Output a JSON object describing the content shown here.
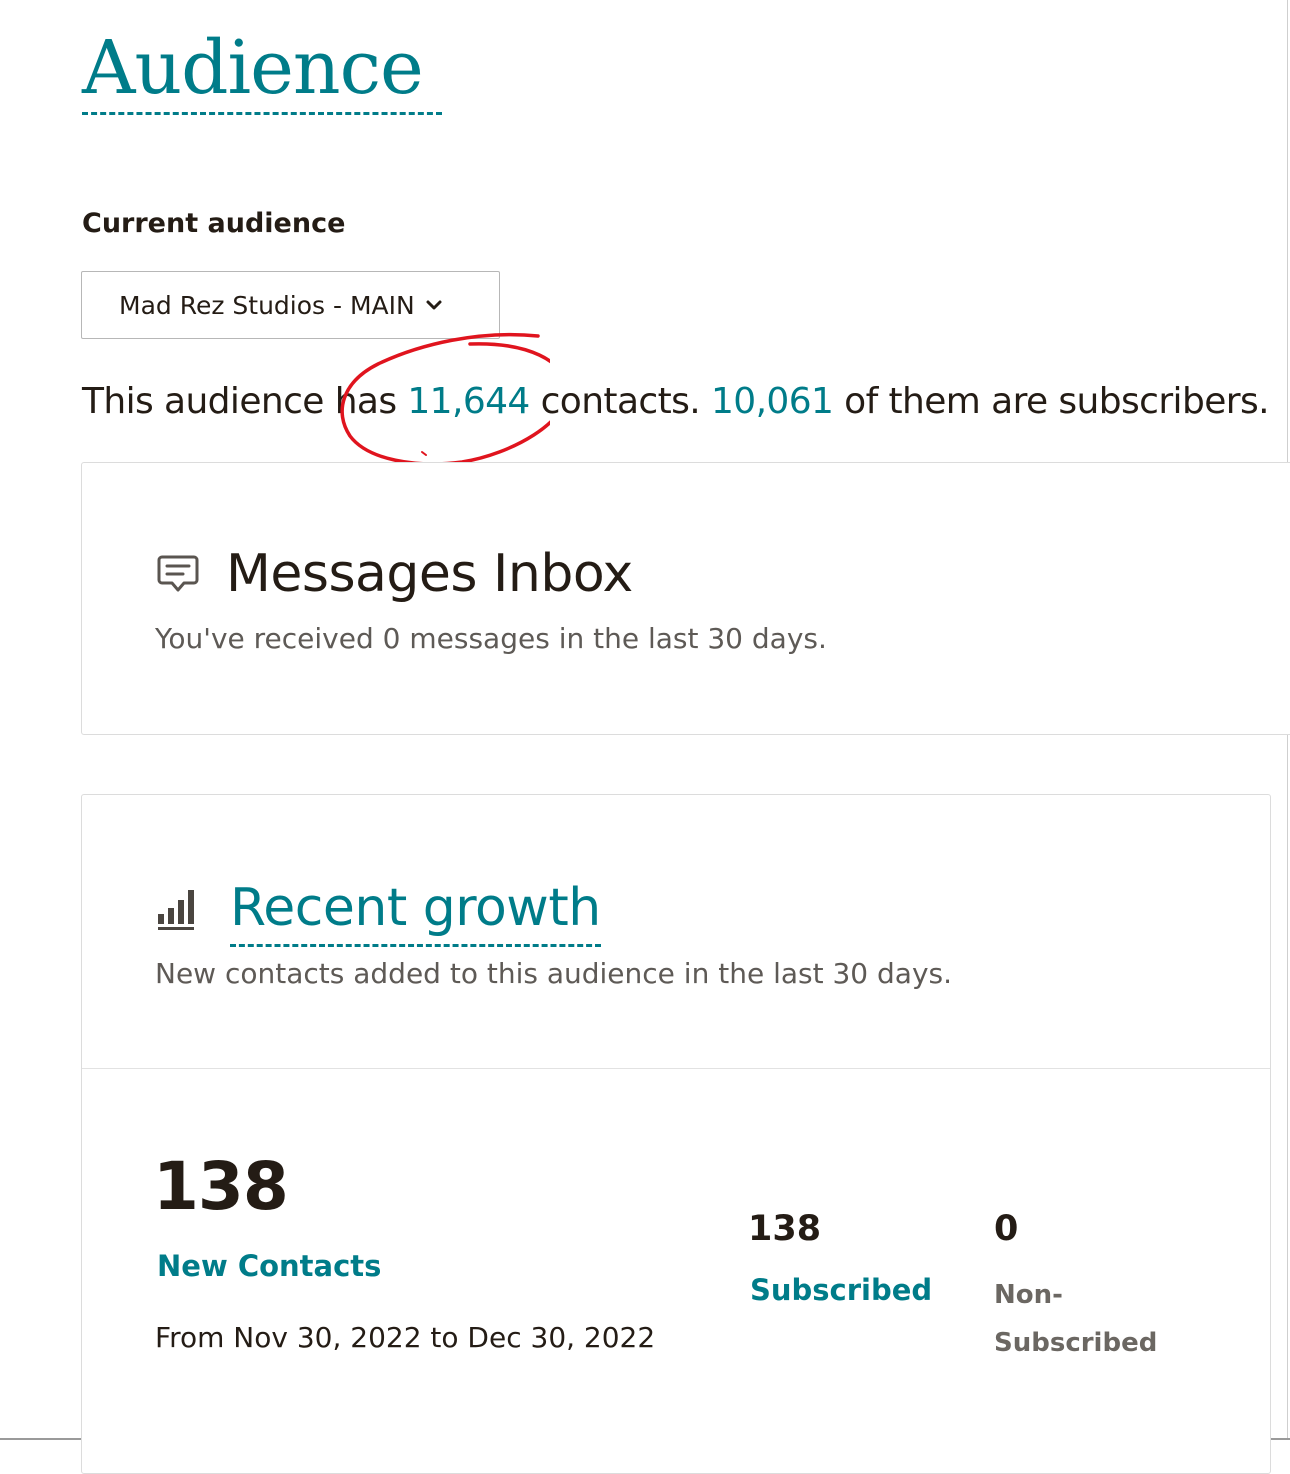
{
  "page": {
    "title": "Audience"
  },
  "current_audience": {
    "label": "Current audience",
    "selected": "Mad Rez Studios - MAIN"
  },
  "summary": {
    "prefix": "This audience has ",
    "contacts": "11,644",
    "middle": " contacts. ",
    "subscribers": "10,061",
    "suffix": " of them are subscribers."
  },
  "inbox": {
    "icon": "message-icon",
    "title": "Messages Inbox",
    "description": "You've received 0 messages in the last 30 days."
  },
  "growth": {
    "icon": "bar-chart-icon",
    "title": "Recent growth",
    "description": "New contacts added to this audience in the last 30 days.",
    "new_contacts_value": "138",
    "new_contacts_label": "New Contacts",
    "date_range": "From Nov 30, 2022 to Dec 30, 2022",
    "subscribed_value": "138",
    "subscribed_label": "Subscribed",
    "non_subscribed_value": "0",
    "non_subscribed_label_line1": "Non-",
    "non_subscribed_label_line2": "Subscribed"
  },
  "colors": {
    "accent": "#007c89",
    "text": "#241c15",
    "muted": "#5e5a56",
    "annotation": "#e0141e"
  }
}
